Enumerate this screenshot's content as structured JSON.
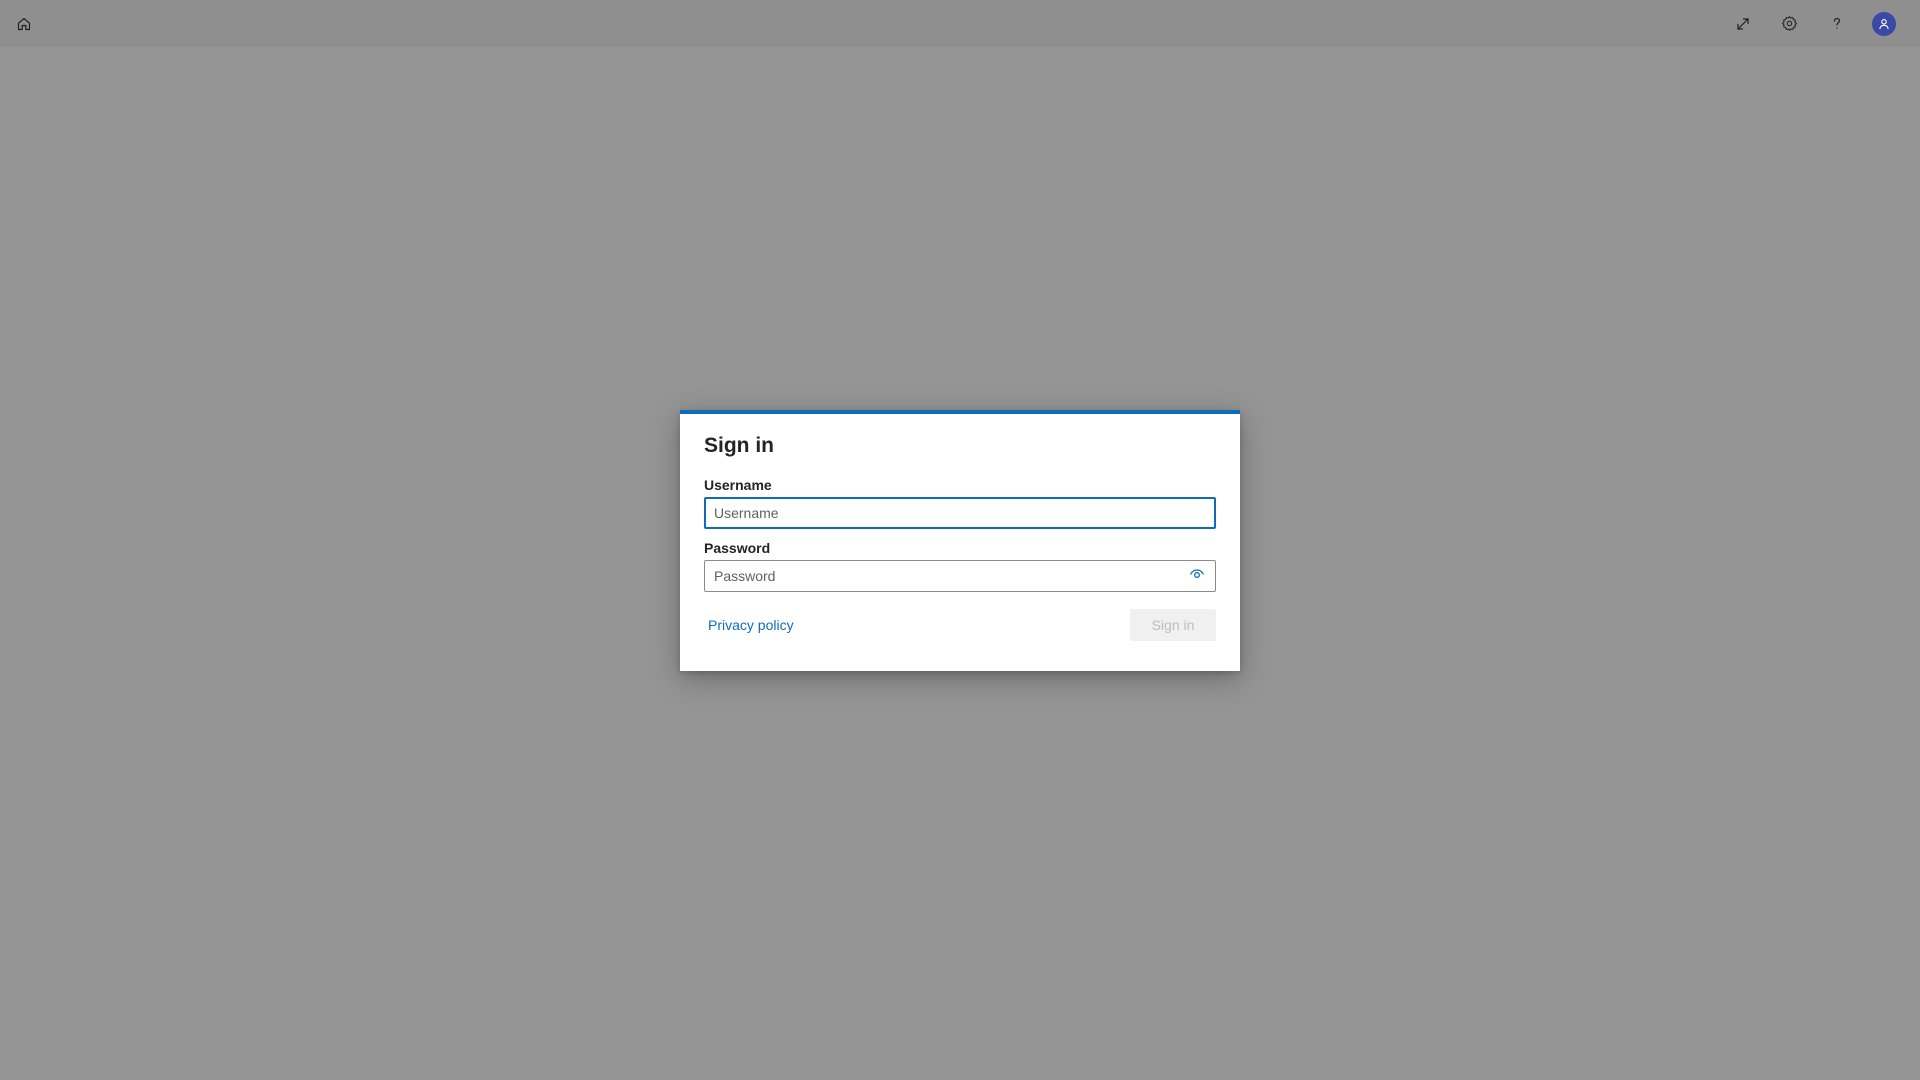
{
  "topbar": {
    "home_icon": "home-icon",
    "expand_icon": "expand-icon",
    "settings_icon": "gear-icon",
    "help_icon": "help-icon",
    "avatar_icon": "user-avatar-icon"
  },
  "dialog": {
    "title": "Sign in",
    "username_label": "Username",
    "username_placeholder": "Username",
    "username_value": "",
    "password_label": "Password",
    "password_placeholder": "Password",
    "password_value": "",
    "show_password_icon": "eye-icon",
    "privacy_link": "Privacy policy",
    "signin_button": "Sign in",
    "signin_enabled": false
  },
  "colors": {
    "accent": "#0f6cbd",
    "avatar_bg": "#3b49a6",
    "overlay": "#959595",
    "disabled_button_bg": "#f0f0f0",
    "disabled_button_text": "#bdbdbd"
  }
}
